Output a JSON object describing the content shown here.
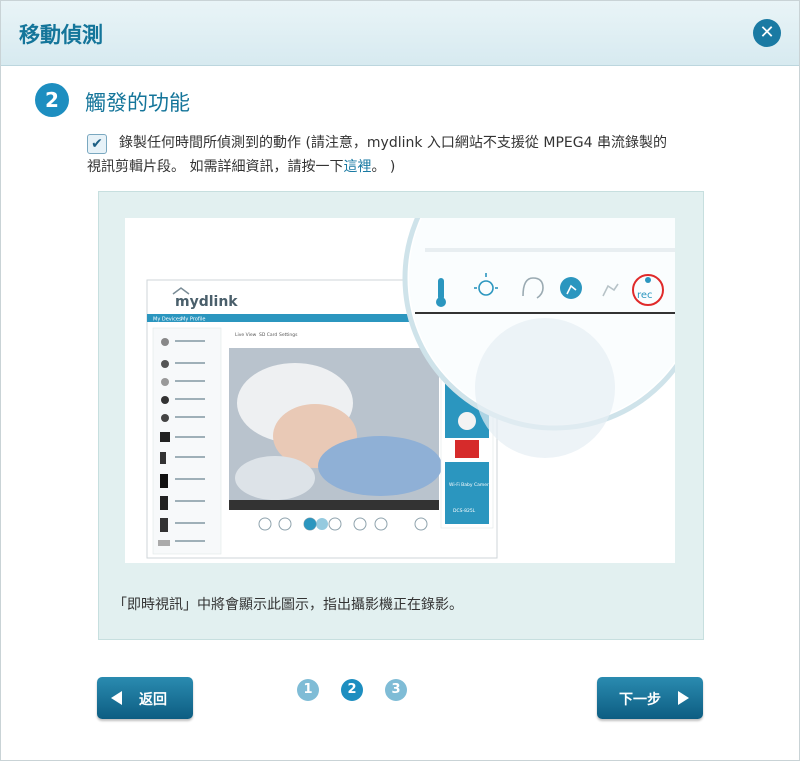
{
  "dialog": {
    "title": "移動偵測",
    "close_icon": "close-icon"
  },
  "step": {
    "number": "2",
    "title": "觸發的功能"
  },
  "option": {
    "checked": true,
    "text_line1": "錄製任何時間所偵測到的動作 (請注意，mydlink 入口網站不支援從 MPEG4 串流錄製的",
    "text_line2_prefix": "視訊剪輯片段。 如需詳細資訊，請按一下",
    "link_text": "這裡",
    "text_line2_suffix": "。 )"
  },
  "panel": {
    "caption": "「即時視訊」中將會顯示此圖示，指出攝影機正在錄影。",
    "screenshot": {
      "logo": "mydlink",
      "tabs": [
        "My Devices",
        "My Profile"
      ],
      "view_tabs": [
        "Live View",
        "SD Card",
        "Settings"
      ],
      "rec_label": "rec",
      "ad_text": "Wi-Fi Baby Camera",
      "ad_model": "DCS-825L",
      "magnifier_icons": [
        "thermometer-icon",
        "light-icon",
        "sound-icon",
        "motion-icon",
        "motion-off-icon",
        "rec-icon"
      ]
    }
  },
  "footer": {
    "back_label": "返回",
    "next_label": "下一步",
    "pages": [
      "1",
      "2",
      "3"
    ],
    "current_page": "2",
    "colors": {
      "active": "#1d8ec0",
      "inactive": "#7fbcd6"
    }
  }
}
